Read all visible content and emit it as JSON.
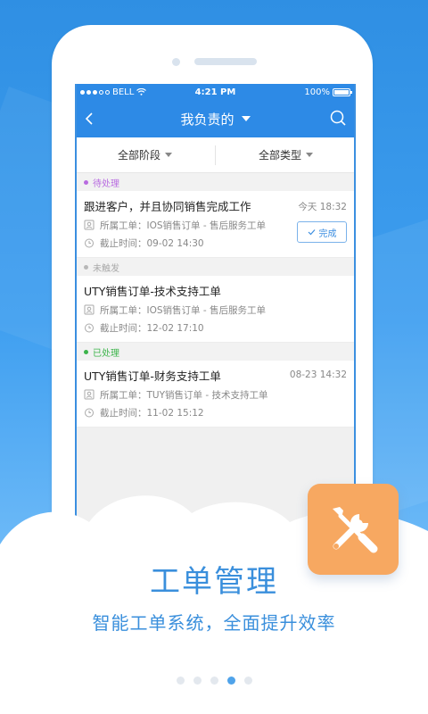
{
  "status_bar": {
    "carrier": "BELL",
    "time": "4:21 PM",
    "battery": "100%"
  },
  "nav": {
    "title": "我负责的"
  },
  "filters": [
    {
      "label": "全部阶段"
    },
    {
      "label": "全部类型"
    }
  ],
  "sections": [
    {
      "label": "待处理",
      "color": "#b86be0",
      "items": [
        {
          "title": "跟进客户，并且协同销售完成工作",
          "time": "今天 18:32",
          "order": "所属工单：IOS销售订单 - 售后服务工单",
          "deadline": "截止时间：09-02 14:30",
          "action": "完成"
        }
      ]
    },
    {
      "label": "未触发",
      "color": "#b7b7b7",
      "items": [
        {
          "title": "UTY销售订单-技术支持工单",
          "time": "",
          "order": "所属工单：IOS销售订单 - 售后服务工单",
          "deadline": "截止时间：12-02 17:10"
        }
      ]
    },
    {
      "label": "已处理",
      "color": "#3cb44b",
      "items": [
        {
          "title": "UTY销售订单-财务支持工单",
          "time": "08-23 14:32",
          "order": "所属工单：TUY销售订单 - 技术支持工单",
          "deadline": "截止时间：11-02 15:12"
        }
      ]
    }
  ],
  "promo": {
    "headline": "工单管理",
    "subline": "智能工单系统，全面提升效率"
  },
  "pager": {
    "count": 5,
    "active_index": 3
  },
  "colors": {
    "brand_blue": "#2d8ae6",
    "accent_orange": "#f7a861",
    "text_blue": "#3a8fdc"
  }
}
